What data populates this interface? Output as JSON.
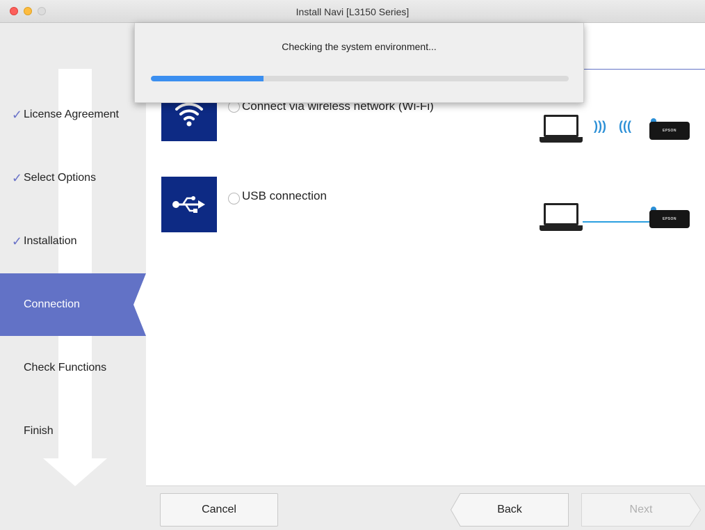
{
  "window": {
    "title": "Install Navi [L3150 Series]"
  },
  "sidebar": {
    "steps": [
      {
        "label": "License Agreement",
        "state": "done",
        "check": "✓"
      },
      {
        "label": "Select Options",
        "state": "done",
        "check": "✓"
      },
      {
        "label": "Installation",
        "state": "done",
        "check": "✓"
      },
      {
        "label": "Connection",
        "state": "active"
      },
      {
        "label": "Check Functions",
        "state": "pending"
      },
      {
        "label": "Finish",
        "state": "pending"
      }
    ]
  },
  "progress": {
    "message": "Checking the system environment...",
    "value_percent": 27
  },
  "options": [
    {
      "label": "Connect via wireless network (Wi-Fi)",
      "icon": "wifi-icon",
      "selected": false,
      "printer_label": "EPSON"
    },
    {
      "label": "USB connection",
      "icon": "usb-icon",
      "selected": false,
      "printer_label": "EPSON"
    }
  ],
  "footer": {
    "cancel_label": "Cancel",
    "back_label": "Back",
    "next_label": "Next"
  },
  "colors": {
    "accent": "#6272c6",
    "icon_bg": "#0d2a84",
    "progress": "#3b8ff0",
    "link_blue": "#2b8fd6"
  }
}
